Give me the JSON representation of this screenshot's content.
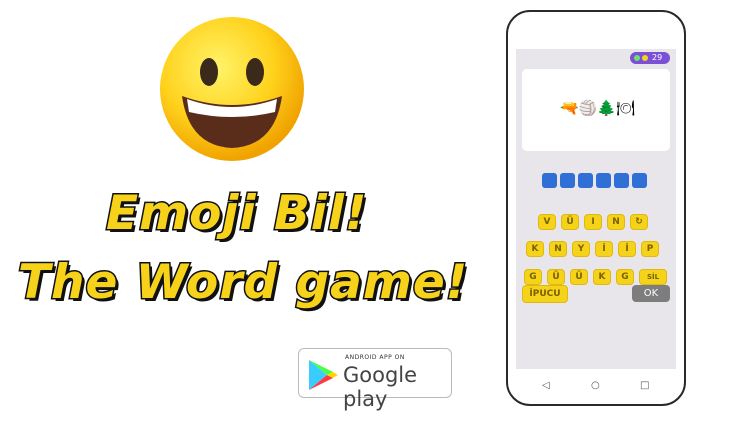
{
  "promo": {
    "title_line1": "Emoji Bil!",
    "title_line2": "The Word game!"
  },
  "store_badge": {
    "small_text": "ANDROID APP ON",
    "big_text": "Google play"
  },
  "game": {
    "coins": "29",
    "clue": "🔫🏐🌲🍽",
    "answer_slots": 6,
    "keyboard_rows": [
      [
        "V",
        "Ü",
        "I",
        "N",
        "↻"
      ],
      [
        "K",
        "N",
        "Y",
        "İ",
        "İ",
        "P"
      ],
      [
        "G",
        "Ü",
        "Ü",
        "K",
        "G",
        "SİL"
      ]
    ],
    "hint_label": "İPUCU",
    "ok_label": "OK"
  },
  "nav": {
    "back": "◁",
    "home": "○",
    "recents": "□"
  },
  "colors": {
    "key": "#f5d31a",
    "slot": "#2f6fd6",
    "pill": "#7b4fd6",
    "title": "#f7d21a"
  }
}
